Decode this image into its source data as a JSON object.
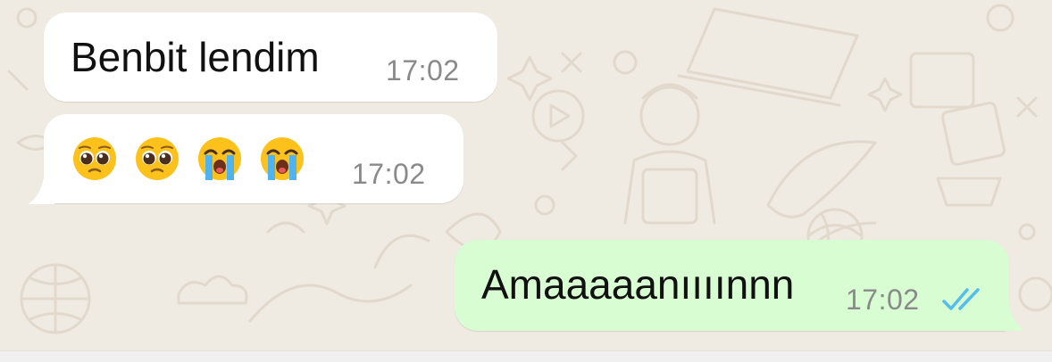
{
  "conversation": {
    "messages": [
      {
        "direction": "incoming",
        "text": "Benbit lendim",
        "time": "17:02"
      },
      {
        "direction": "incoming",
        "emojis": [
          "pleading-face",
          "pleading-face",
          "loudly-crying-face",
          "loudly-crying-face"
        ],
        "time": "17:02"
      },
      {
        "direction": "outgoing",
        "text": "Amaaaaanıııınnn",
        "time": "17:02",
        "status": "read"
      }
    ]
  },
  "colors": {
    "background": "#efeae2",
    "incoming_bubble": "#ffffff",
    "outgoing_bubble": "#d9fdd3",
    "read_ticks": "#53bdeb",
    "timestamp": "#8a8a8a"
  }
}
